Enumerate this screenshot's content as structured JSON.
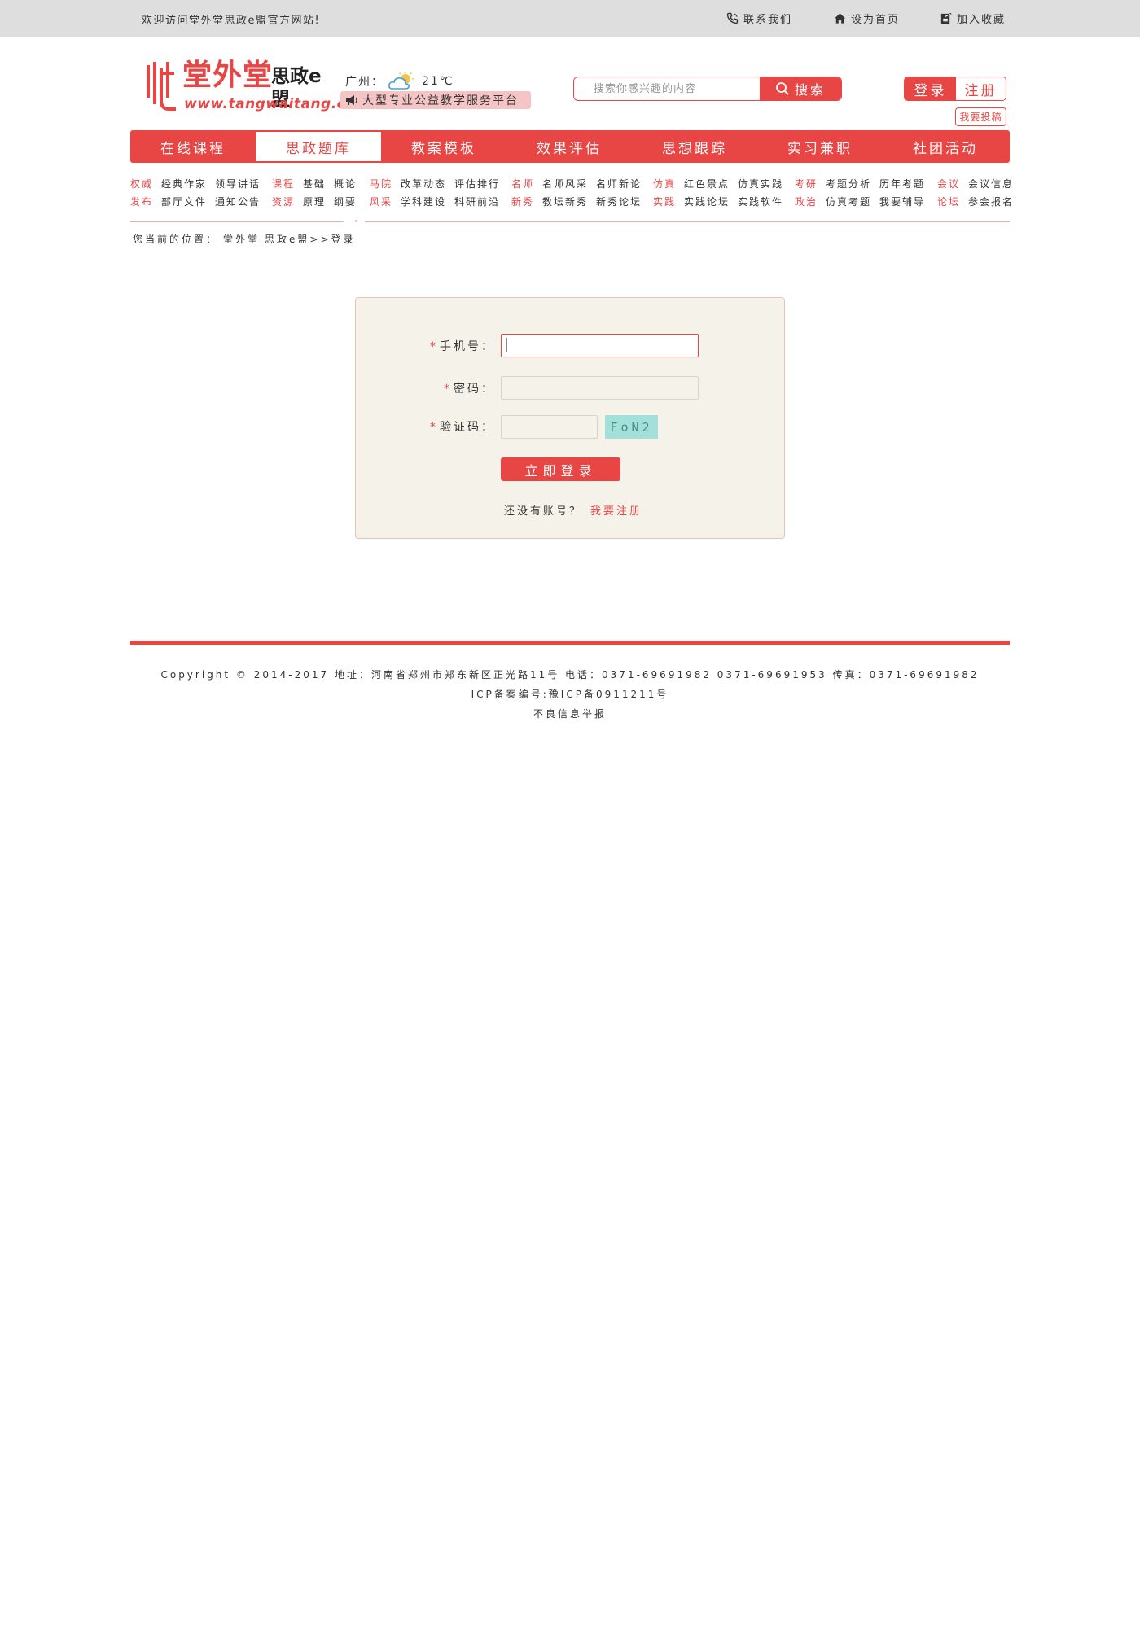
{
  "topbar": {
    "welcome": "欢迎访问堂外堂思政e盟官方网站!",
    "links": [
      {
        "label": "联系我们",
        "icon": "phone-icon"
      },
      {
        "label": "设为首页",
        "icon": "home-icon"
      },
      {
        "label": "加入收藏",
        "icon": "bookmark-icon"
      }
    ]
  },
  "header": {
    "logo": {
      "brand": "堂外堂",
      "sub": "思政e盟",
      "url": "www.tangwaitang.cn"
    },
    "weather": {
      "city": "广州：",
      "temp": "21℃",
      "icon": "partly-cloudy-icon"
    },
    "slogan": "大型专业公益教学服务平台",
    "search": {
      "placeholder": "搜索你感兴趣的内容",
      "button": "搜索"
    },
    "auth": {
      "login": "登录",
      "register": "注册"
    },
    "submit_button": "我要投稿"
  },
  "nav": {
    "items": [
      "在线课程",
      "思政题库",
      "教案模板",
      "效果评估",
      "思想跟踪",
      "实习兼职",
      "社团活动"
    ],
    "active_index": 1
  },
  "subnav": [
    {
      "rows": [
        {
          "cat": "权威",
          "links": [
            "经典作家",
            "领导讲话"
          ]
        },
        {
          "cat": "发布",
          "links": [
            "部厅文件",
            "通知公告"
          ]
        }
      ]
    },
    {
      "rows": [
        {
          "cat": "课程",
          "links": [
            "基础",
            "概论"
          ]
        },
        {
          "cat": "资源",
          "links": [
            "原理",
            "纲要"
          ]
        }
      ]
    },
    {
      "rows": [
        {
          "cat": "马院",
          "links": [
            "改革动态",
            "评估排行"
          ]
        },
        {
          "cat": "风采",
          "links": [
            "学科建设",
            "科研前沿"
          ]
        }
      ]
    },
    {
      "rows": [
        {
          "cat": "名师",
          "links": [
            "名师风采",
            "名师新论"
          ]
        },
        {
          "cat": "新秀",
          "links": [
            "教坛新秀",
            "新秀论坛"
          ]
        }
      ]
    },
    {
      "rows": [
        {
          "cat": "仿真",
          "links": [
            "红色景点",
            "仿真实践"
          ]
        },
        {
          "cat": "实践",
          "links": [
            "实践论坛",
            "实践软件"
          ]
        }
      ]
    },
    {
      "rows": [
        {
          "cat": "考研",
          "links": [
            "考题分析",
            "历年考题"
          ]
        },
        {
          "cat": "政治",
          "links": [
            "仿真考题",
            "我要辅导"
          ]
        }
      ]
    },
    {
      "rows": [
        {
          "cat": "会议",
          "links": [
            "会议信息"
          ]
        },
        {
          "cat": "论坛",
          "links": [
            "参会报名"
          ]
        }
      ]
    }
  ],
  "breadcrumb": {
    "prefix": "您当前的位置：",
    "items": [
      "堂外堂",
      "思政e盟>>登录"
    ]
  },
  "login": {
    "phone_label": "手机号：",
    "password_label": "密码：",
    "captcha_label": "验证码：",
    "required_mark": "*",
    "phone_value": "",
    "password_value": "",
    "captcha_value": "",
    "captcha_code": "FoN2",
    "submit": "立即登录",
    "no_account": "还没有账号？",
    "register_link": "我要注册"
  },
  "footer": {
    "copyright": "Copyright © 2014-2017 地址：河南省郑州市郑东新区正光路11号 电话：0371-69691982 0371-69691953 传真：0371-69691982",
    "icp": "ICP备案编号:豫ICP备0911211号",
    "report": "不良信息举报"
  },
  "colors": {
    "accent": "#e84545",
    "box_bg": "#f4f2e9",
    "captcha_bg": "#a3e0d9",
    "topbar_bg": "#dedede"
  }
}
